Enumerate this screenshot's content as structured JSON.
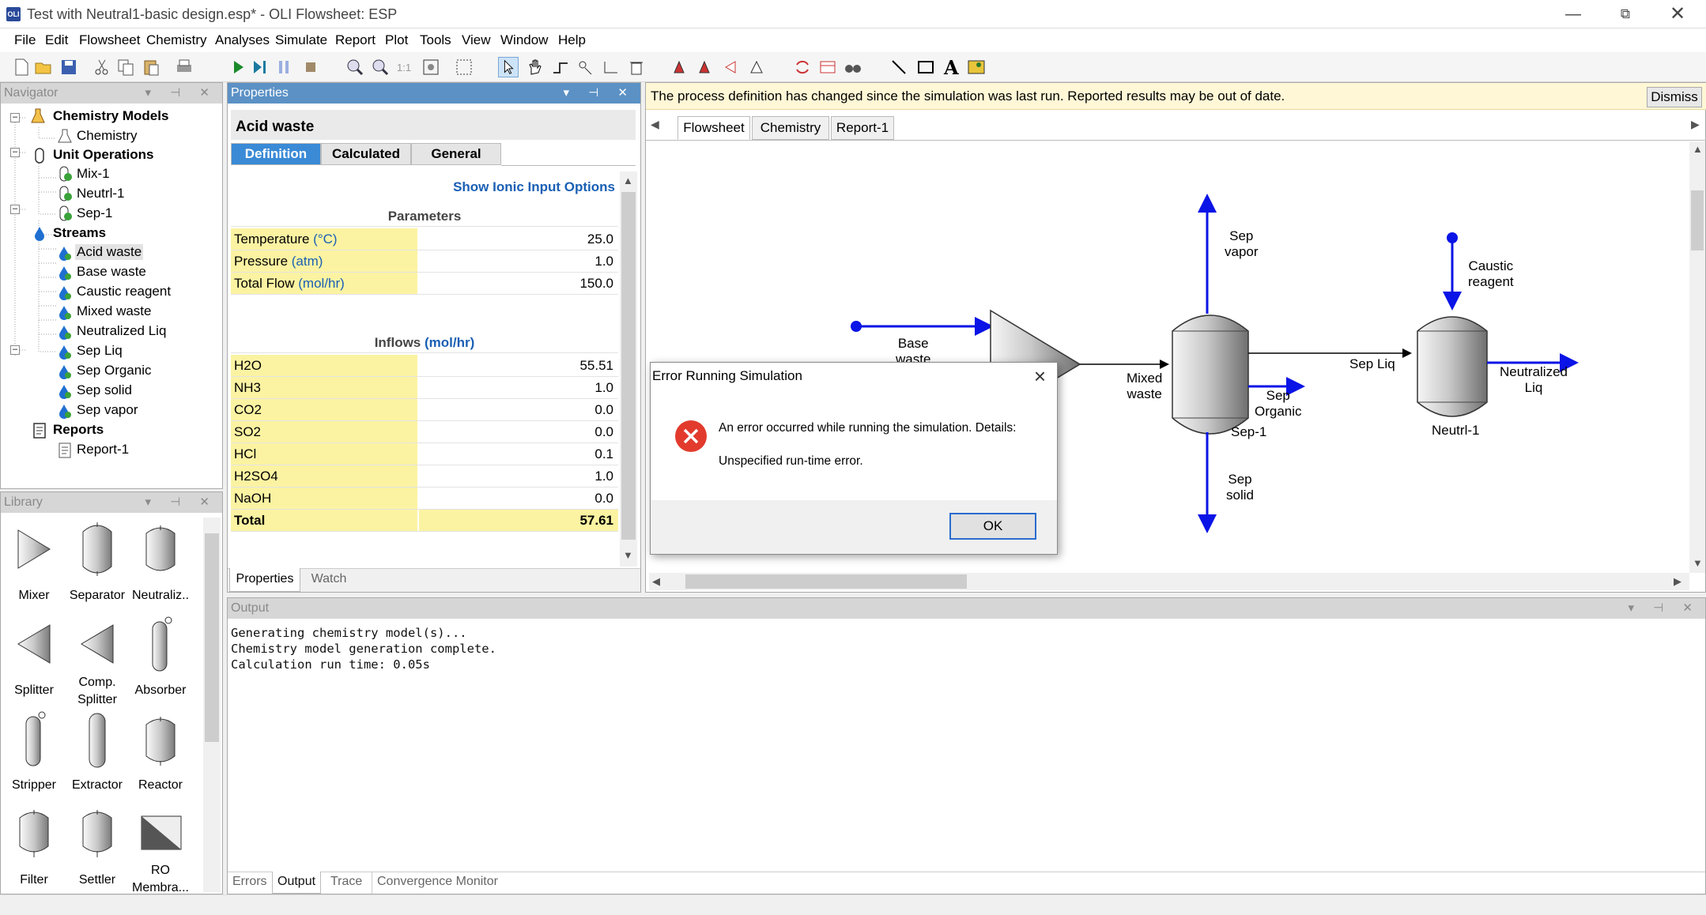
{
  "window": {
    "title": "Test with Neutral1-basic design.esp* - OLI Flowsheet: ESP"
  },
  "menu": [
    "File",
    "Edit",
    "Flowsheet",
    "Chemistry",
    "Analyses",
    "Simulate",
    "Report",
    "Plot",
    "Tools",
    "View",
    "Window",
    "Help"
  ],
  "navigator": {
    "title": "Navigator",
    "groups": [
      {
        "label": "Chemistry Models",
        "items": [
          "Chemistry"
        ]
      },
      {
        "label": "Unit Operations",
        "items": [
          "Mix-1",
          "Neutrl-1",
          "Sep-1"
        ]
      },
      {
        "label": "Streams",
        "items": [
          "Acid waste",
          "Base waste",
          "Caustic reagent",
          "Mixed waste",
          "Neutralized Liq",
          "Sep Liq",
          "Sep Organic",
          "Sep solid",
          "Sep vapor"
        ]
      },
      {
        "label": "Reports",
        "items": [
          "Report-1"
        ]
      }
    ],
    "selected": "Acid waste"
  },
  "library": {
    "title": "Library",
    "items": [
      "Mixer",
      "Separator",
      "Neutraliz..",
      "Splitter",
      "Comp.\nSplitter",
      "Absorber",
      "Stripper",
      "Extractor",
      "Reactor",
      "Filter",
      "Settler",
      "RO\nMembra..."
    ]
  },
  "properties": {
    "title": "Properties",
    "object": "Acid waste",
    "tabs": [
      "Definition",
      "Calculated",
      "General"
    ],
    "link": "Show Ionic Input Options",
    "params_header": "Parameters",
    "params": [
      {
        "name": "Temperature",
        "unit": "(°C)",
        "value": "25.0"
      },
      {
        "name": "Pressure",
        "unit": "(atm)",
        "value": "1.0"
      },
      {
        "name": "Total Flow",
        "unit": "(mol/hr)",
        "value": "150.0"
      }
    ],
    "inflows_header": "Inflows",
    "inflows_unit": "(mol/hr)",
    "inflows": [
      {
        "name": "H2O",
        "value": "55.51"
      },
      {
        "name": "NH3",
        "value": "1.0"
      },
      {
        "name": "CO2",
        "value": "0.0"
      },
      {
        "name": "SO2",
        "value": "0.0"
      },
      {
        "name": "HCl",
        "value": "0.1"
      },
      {
        "name": "H2SO4",
        "value": "1.0"
      },
      {
        "name": "NaOH",
        "value": "0.0"
      }
    ],
    "total": {
      "name": "Total",
      "value": "57.61"
    },
    "bottom_tabs": [
      "Properties",
      "Watch"
    ]
  },
  "banner": {
    "message": "The process definition has changed since the simulation was last run. Reported results may be out of date.",
    "dismiss": "Dismiss"
  },
  "doc_tabs": [
    "Flowsheet",
    "Chemistry",
    "Report-1"
  ],
  "flowsheet": {
    "labels": {
      "base_waste": "Base\nwaste",
      "mixed_waste": "Mixed\nwaste",
      "sep_vapor": "Sep\nvapor",
      "sep_organic": "Sep\nOrganic",
      "sep1": "Sep-1",
      "sep_solid": "Sep\nsolid",
      "sep_liq": "Sep Liq",
      "caustic": "Caustic\nreagent",
      "neutralized": "Neutralized\nLiq",
      "neutrl1": "Neutrl-1"
    }
  },
  "dialog": {
    "title": "Error Running Simulation",
    "line1": "An error occurred while running the simulation. Details:",
    "line2": "Unspecified run-time error.",
    "ok": "OK"
  },
  "output": {
    "title": "Output",
    "text": "Generating chemistry model(s)...\nChemistry model generation complete.\nCalculation run time: 0.05s",
    "tabs": [
      "Errors",
      "Output",
      "Trace",
      "Convergence Monitor"
    ],
    "active_tab": "Output"
  },
  "colors": {
    "stream": "#0a14e6",
    "panel_active": "#5b91c5",
    "highlight": "#fbf3a2",
    "tab_active": "#3a8ad6",
    "error": "#e23b2e"
  }
}
